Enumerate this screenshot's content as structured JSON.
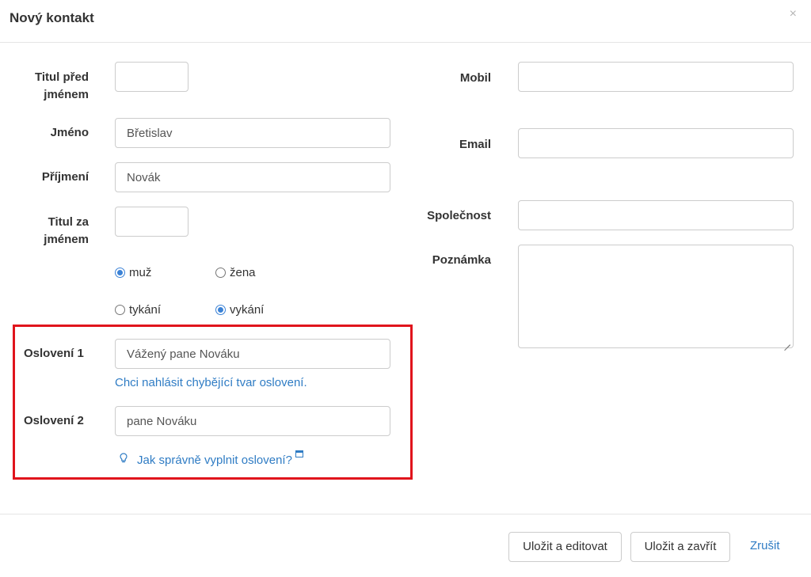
{
  "header": {
    "title": "Nový kontakt",
    "close": "×"
  },
  "left": {
    "titul_pred": {
      "label_line1": "Titul před",
      "label_line2": "jménem",
      "value": ""
    },
    "jmeno": {
      "label": "Jméno",
      "value": "Břetislav"
    },
    "prijmeni": {
      "label": "Příjmení",
      "value": "Novák"
    },
    "titul_za": {
      "label_line1": "Titul za",
      "label_line2": "jménem",
      "value": ""
    },
    "gender": {
      "option1": "muž",
      "option2": "žena",
      "selected": "muž"
    },
    "address": {
      "option1": "tykání",
      "option2": "vykání",
      "selected": "vykání"
    },
    "osloveni1": {
      "label": "Oslovení 1",
      "value": "Vážený pane Nováku"
    },
    "report_link": "Chci nahlásit chybějící tvar oslovení.",
    "osloveni2": {
      "label": "Oslovení 2",
      "value": "pane Nováku"
    },
    "help_link": "Jak správně vyplnit oslovení?"
  },
  "right": {
    "mobil": {
      "label": "Mobil",
      "value": ""
    },
    "email": {
      "label": "Email",
      "value": ""
    },
    "spolecnost": {
      "label": "Společnost",
      "value": ""
    },
    "poznamka": {
      "label": "Poznámka",
      "value": ""
    }
  },
  "footer": {
    "save_edit": "Uložit a editovat",
    "save_close": "Uložit a zavřít",
    "cancel": "Zrušit"
  },
  "colors": {
    "highlight": "#e0141c",
    "link": "#2f7cc4",
    "radio_checked": "#3b82d6"
  },
  "icons": {
    "help": "lightbulb-icon",
    "external": "external-link-icon"
  }
}
